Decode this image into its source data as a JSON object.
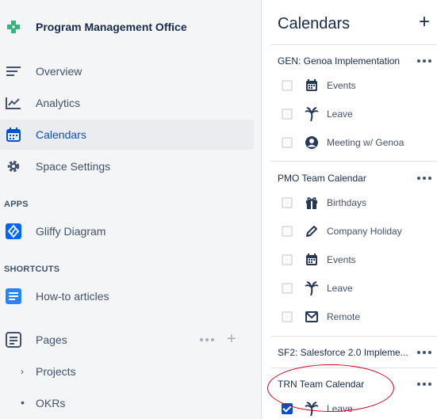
{
  "sidebar": {
    "space_title": "Program Management Office",
    "nav": {
      "overview": "Overview",
      "analytics": "Analytics",
      "calendars": "Calendars",
      "space_settings": "Space Settings"
    },
    "apps_section": "APPS",
    "apps": {
      "gliffy": "Gliffy Diagram"
    },
    "shortcuts_section": "SHORTCUTS",
    "shortcuts": {
      "howto": "How-to articles"
    },
    "pages_label": "Pages",
    "pages_tree": [
      "Projects",
      "OKRs"
    ]
  },
  "panel": {
    "title": "Calendars",
    "add_label": "+",
    "groups": [
      {
        "title": "GEN: Genoa Implementation",
        "items": [
          {
            "label": "Events",
            "icon": "calendar-icon",
            "checked": false
          },
          {
            "label": "Leave",
            "icon": "palm-tree-icon",
            "checked": false
          },
          {
            "label": "Meeting w/ Genoa",
            "icon": "person-icon",
            "checked": false
          }
        ]
      },
      {
        "title": "PMO Team Calendar",
        "items": [
          {
            "label": "Birthdays",
            "icon": "gift-icon",
            "checked": false
          },
          {
            "label": "Company Holiday",
            "icon": "pencil-icon",
            "checked": false
          },
          {
            "label": "Events",
            "icon": "calendar-icon",
            "checked": false
          },
          {
            "label": "Leave",
            "icon": "palm-tree-icon",
            "checked": false
          },
          {
            "label": "Remote",
            "icon": "envelope-icon",
            "checked": false
          }
        ]
      },
      {
        "title": "SF2: Salesforce 2.0 Impleme...",
        "items": []
      },
      {
        "title": "TRN Team Calendar",
        "items": [
          {
            "label": "Leave",
            "icon": "palm-tree-icon",
            "checked": true
          }
        ]
      }
    ]
  },
  "colors": {
    "accent": "#0052CC",
    "annotation": "#D0021B",
    "sidebar_bg": "#F4F5F7"
  }
}
